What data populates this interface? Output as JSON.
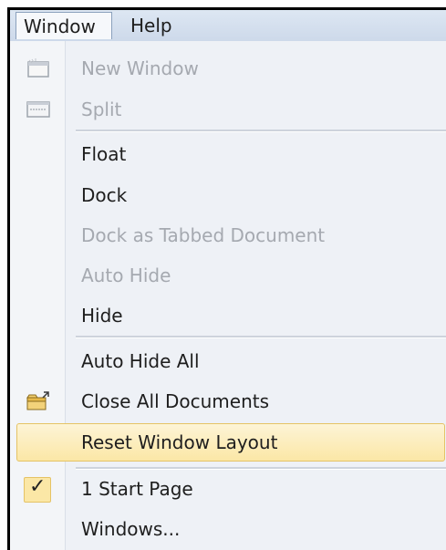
{
  "menubar": {
    "items": [
      {
        "label": "Window",
        "active": true
      },
      {
        "label": "Help",
        "active": false
      }
    ]
  },
  "menu": {
    "items": [
      {
        "label": "New Window",
        "enabled": false,
        "icon": "new-window-icon"
      },
      {
        "label": "Split",
        "enabled": false,
        "icon": "split-icon"
      },
      {
        "label": "Float",
        "enabled": true
      },
      {
        "label": "Dock",
        "enabled": true
      },
      {
        "label": "Dock as Tabbed Document",
        "enabled": false
      },
      {
        "label": "Auto Hide",
        "enabled": false
      },
      {
        "label": "Hide",
        "enabled": true
      },
      {
        "label": "Auto Hide All",
        "enabled": true
      },
      {
        "label": "Close All Documents",
        "enabled": true,
        "icon": "folder-close-icon"
      },
      {
        "label": "Reset Window Layout",
        "enabled": true,
        "highlighted": true
      },
      {
        "label": "1 Start Page",
        "enabled": true,
        "checked": true
      },
      {
        "label": "Windows...",
        "enabled": true
      }
    ],
    "check_glyph": "✓"
  },
  "colors": {
    "highlight": "#fbe7a6",
    "highlight_border": "#e5c365",
    "disabled_text": "#a5a9b0",
    "menubar": "#cdd9ea"
  }
}
